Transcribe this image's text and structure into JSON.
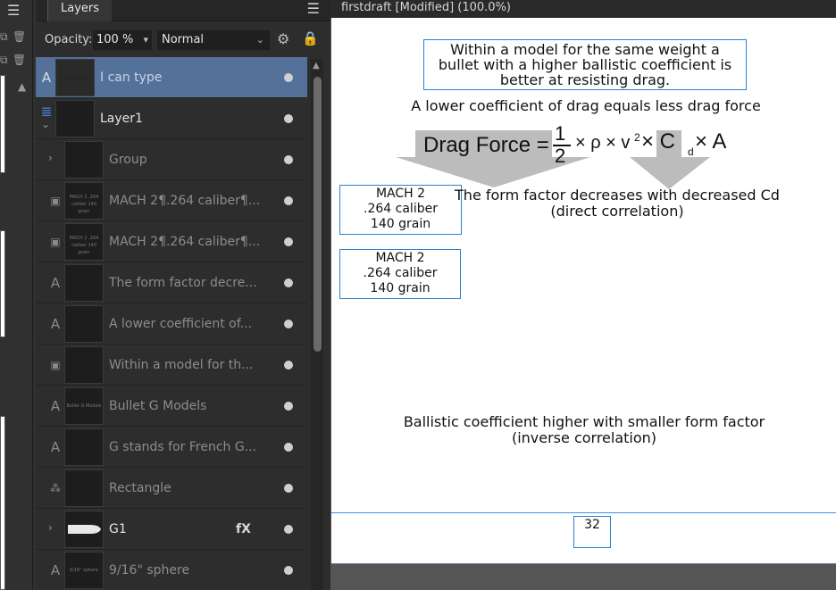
{
  "left_strip": {
    "menu_icon": "hamburger-icon"
  },
  "layers_panel": {
    "tab": "Layers",
    "opacity_label": "Opacity:",
    "opacity_value": "100 %",
    "blend_mode": "Normal",
    "items": [
      {
        "type": "A",
        "name": "I can type",
        "thumb_text": "I can type",
        "selected": true,
        "strong": false
      },
      {
        "type": "layer",
        "name": "Layer1",
        "thumb_text": "",
        "selected": false,
        "strong": true
      },
      {
        "type": "group",
        "name": "Group",
        "thumb_text": "",
        "selected": false,
        "strong": false
      },
      {
        "type": "T",
        "name": "MACH 2¶.264 caliber¶...",
        "thumb_text": "MACH 2 .264 caliber 140 grain",
        "selected": false,
        "strong": false
      },
      {
        "type": "T",
        "name": "MACH 2¶.264 caliber¶...",
        "thumb_text": "MACH 2 .264 caliber 140 grain",
        "selected": false,
        "strong": false
      },
      {
        "type": "A",
        "name": "The form factor decre...",
        "thumb_text": "",
        "selected": false,
        "strong": false
      },
      {
        "type": "A",
        "name": "A lower coefficient of...",
        "thumb_text": "",
        "selected": false,
        "strong": false
      },
      {
        "type": "T",
        "name": "Within a model for th...",
        "thumb_text": "",
        "selected": false,
        "strong": false
      },
      {
        "type": "A",
        "name": "Bullet G Models",
        "thumb_text": "Bullet G Models",
        "selected": false,
        "strong": false
      },
      {
        "type": "A",
        "name": "G stands for French G...",
        "thumb_text": "",
        "selected": false,
        "strong": false
      },
      {
        "type": "shape",
        "name": "Rectangle",
        "thumb_text": "",
        "selected": false,
        "strong": false
      },
      {
        "type": "group",
        "name": "G1",
        "thumb_text": "",
        "selected": false,
        "strong": true,
        "fx": "fX"
      },
      {
        "type": "A",
        "name": "9/16\" sphere",
        "thumb_text": "9/16\" sphere",
        "selected": false,
        "strong": false
      }
    ]
  },
  "document": {
    "title": "firstdraft [Modified] (100.0%)",
    "boxed_text": [
      "Within a model for the same weight a",
      "bullet with a higher ballistic coefficient is",
      "better at resisting drag."
    ],
    "subtitle": "A lower coefficient of drag equals less drag force",
    "formula": {
      "prefix": "Drag Force =",
      "numerator": "1",
      "denominator": "2",
      "middle": "× ρ × v",
      "sq": "2",
      "times": " × C",
      "sub": "d",
      "suffix": " × A"
    },
    "mach_box_1": [
      "MACH 2",
      ".264 caliber",
      "140 grain"
    ],
    "mach_box_2": [
      "MACH 2",
      ".264 caliber",
      "140 grain"
    ],
    "form_factor_note": [
      "The form factor decreases with decreased Cd",
      "(direct correlation)"
    ],
    "ballistic_note": [
      "Ballistic coefficient higher with smaller form factor",
      "(inverse correlation)"
    ],
    "page_number": "32"
  }
}
